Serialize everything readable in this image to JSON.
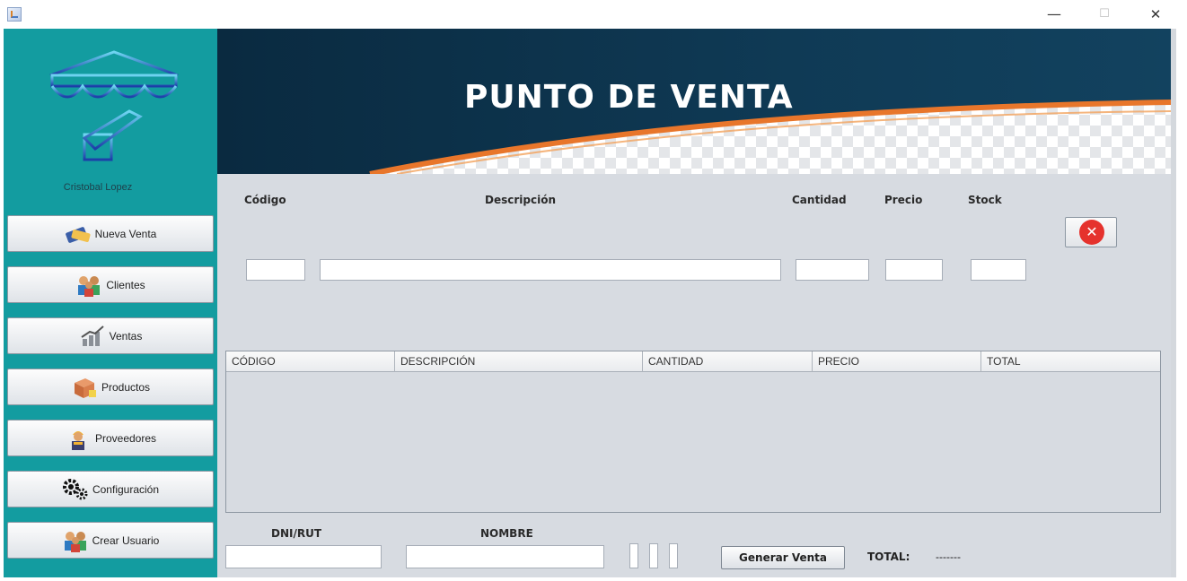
{
  "window": {
    "minimize": "—",
    "maximize": "☐",
    "close": "✕"
  },
  "sidebar": {
    "user_name": "Cristobal Lopez",
    "items": [
      {
        "label": "Nueva Venta",
        "icon": "cash-card-icon"
      },
      {
        "label": "Clientes",
        "icon": "people-group-icon"
      },
      {
        "label": "Ventas",
        "icon": "sales-chart-icon"
      },
      {
        "label": "Productos",
        "icon": "box-icon"
      },
      {
        "label": "Proveedores",
        "icon": "worker-icon"
      },
      {
        "label": "Configuración",
        "icon": "gears-icon"
      },
      {
        "label": "Crear Usuario",
        "icon": "people-group-icon"
      }
    ]
  },
  "banner": {
    "title": "PUNTO DE VENTA"
  },
  "form": {
    "codigo": "Código",
    "descripcion": "Descripción",
    "cantidad": "Cantidad",
    "precio": "Precio",
    "stock": "Stock",
    "values": {
      "codigo": "",
      "descripcion": "",
      "cantidad": "",
      "precio": "",
      "stock": ""
    }
  },
  "table": {
    "columns": [
      "CÓDIGO",
      "DESCRIPCIÓN",
      "CANTIDAD",
      "PRECIO",
      "TOTAL"
    ],
    "rows": []
  },
  "footer": {
    "dni_label": "DNI/RUT",
    "nombre_label": "NOMBRE",
    "dni_value": "",
    "nombre_value": "",
    "generate_label": "Generar Venta",
    "total_label": "TOTAL:",
    "total_value": "-------"
  },
  "colors": {
    "sidebar": "#139ca0",
    "banner_dark": "#0e2d45",
    "banner_accent": "#e8762b",
    "background": "#d7dbe1",
    "delete_red": "#e5322d"
  }
}
